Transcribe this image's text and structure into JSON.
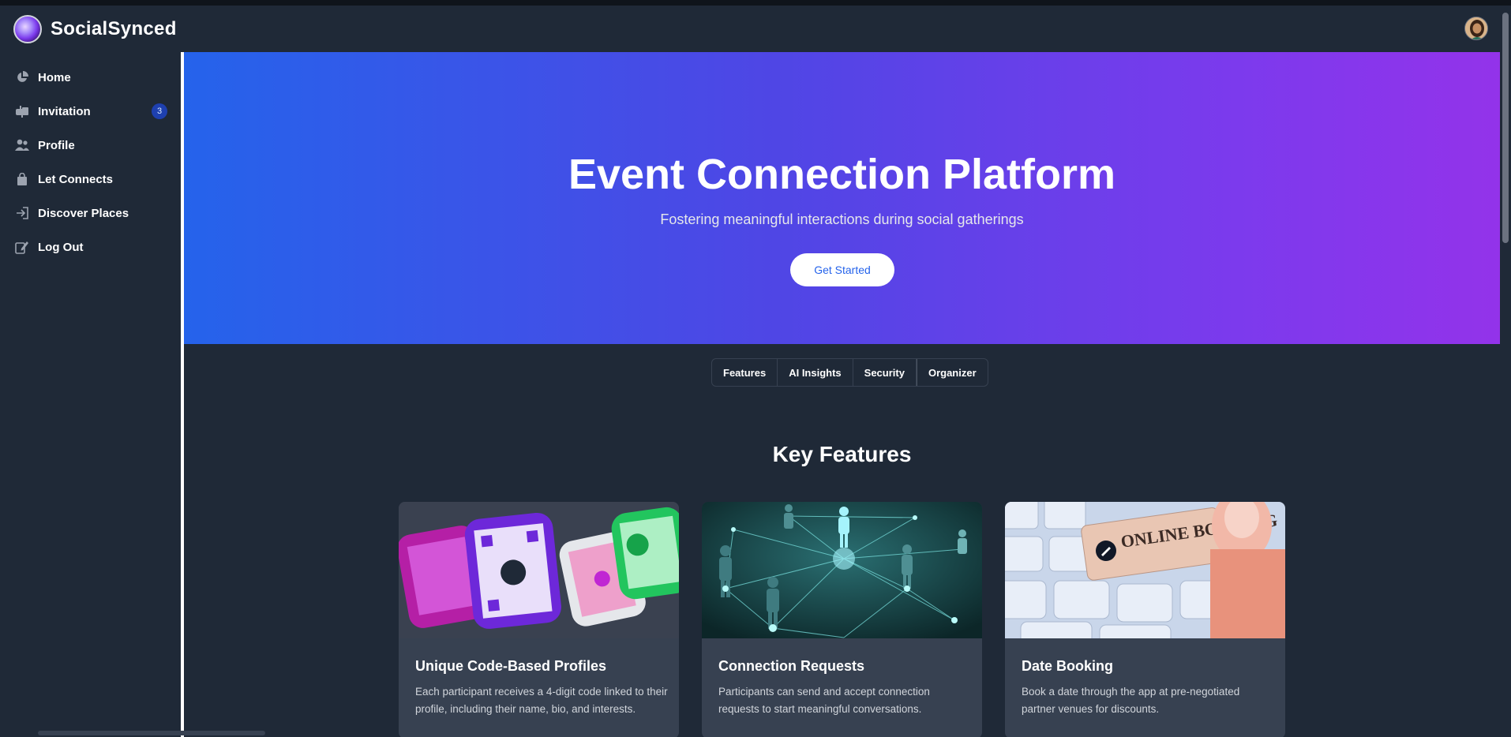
{
  "app": {
    "brand": "SocialSynced"
  },
  "sidebar": {
    "items": [
      {
        "label": "Home",
        "icon": "pie-chart-icon"
      },
      {
        "label": "Invitation",
        "icon": "mailbox-icon",
        "badge": "3"
      },
      {
        "label": "Profile",
        "icon": "users-icon"
      },
      {
        "label": "Let Connects",
        "icon": "shopping-bag-icon"
      },
      {
        "label": "Discover Places",
        "icon": "sign-in-icon"
      },
      {
        "label": "Log Out",
        "icon": "edit-icon"
      }
    ]
  },
  "hero": {
    "title": "Event Connection Platform",
    "subtitle": "Fostering meaningful interactions during social gatherings",
    "cta": "Get Started"
  },
  "tabs": [
    "Features",
    "AI Insights",
    "Security",
    "Organizer"
  ],
  "features": {
    "title": "Key Features",
    "cards": [
      {
        "title": "Unique Code-Based Profiles",
        "text": "Each participant receives a 4-digit code linked to their profile, including their name, bio, and interests."
      },
      {
        "title": "Connection Requests",
        "text": "Participants can send and accept connection requests to start meaningful conversations."
      },
      {
        "title": "Date Booking",
        "text": "Book a date through the app at pre-negotiated partner venues for discounts."
      }
    ],
    "card_images": [
      {
        "text": ""
      },
      {
        "text": ""
      },
      {
        "text": "ONLINE BOOKING"
      }
    ]
  },
  "colors": {
    "background": "#1f2937",
    "hero_start": "#2563eb",
    "hero_end": "#9333ea",
    "badge": "#1e40af",
    "card": "#374151"
  }
}
